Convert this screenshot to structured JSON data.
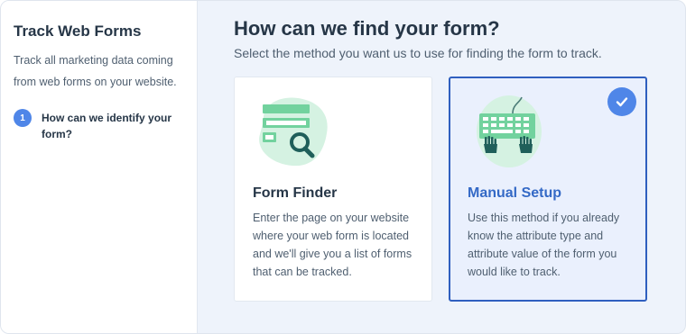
{
  "sidebar": {
    "title": "Track Web Forms",
    "description": "Track all marketing data coming from web forms on your website.",
    "steps": [
      {
        "number": "1",
        "label": "How can we identify your form?"
      }
    ]
  },
  "main": {
    "title": "How can we find your form?",
    "subtitle": "Select the method you want us to use for finding the form to track.",
    "options": [
      {
        "title": "Form Finder",
        "description": "Enter the page on your website where your web form is located and we'll give you a list of forms that can be tracked.",
        "icon": "form-search-illustration",
        "selected": false
      },
      {
        "title": "Manual Setup",
        "description": "Use this method if you already know the attribute type and attribute value of the form you would like to track.",
        "icon": "keyboard-hands-illustration",
        "selected": true
      }
    ]
  },
  "colors": {
    "accent": "#4f86e8",
    "selected_border": "#2f5fbf",
    "selected_title": "#3469c6",
    "illustration_green": "#6fcf9a",
    "illustration_dark": "#1f5f5a"
  }
}
